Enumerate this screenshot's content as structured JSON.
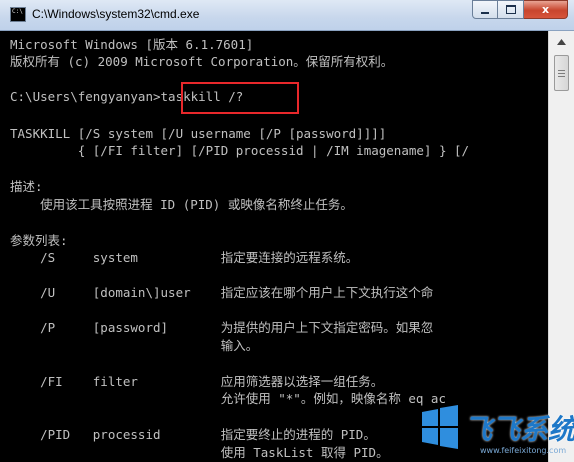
{
  "window": {
    "title": "C:\\Windows\\system32\\cmd.exe",
    "icon_text": "C:\\",
    "close_glyph": "x"
  },
  "console": {
    "lines": [
      "Microsoft Windows [版本 6.1.7601]",
      "版权所有 (c) 2009 Microsoft Corporation。保留所有权利。",
      "",
      "C:\\Users\\fengyanyan>taskkill /?",
      "",
      "TASKKILL [/S system [/U username [/P [password]]]]",
      "         { [/FI filter] [/PID processid | /IM imagename] } [/",
      "",
      "描述:",
      "    使用该工具按照进程 ID (PID) 或映像名称终止任务。",
      "",
      "参数列表:",
      "    /S     system           指定要连接的远程系统。",
      "",
      "    /U     [domain\\]user    指定应该在哪个用户上下文执行这个命",
      "",
      "    /P     [password]       为提供的用户上下文指定密码。如果忽",
      "                            输入。",
      "",
      "    /FI    filter           应用筛选器以选择一组任务。",
      "                            允许使用 \"*\"。例如，映像名称 eq ac",
      "",
      "    /PID   processid        指定要终止的进程的 PID。",
      "                            使用 TaskList 取得 PID。"
    ]
  },
  "watermark": {
    "text": "飞飞系统",
    "url": "www.feifeixitong.com"
  },
  "colors": {
    "console_bg": "#000000",
    "console_fg": "#c0c0c0",
    "highlight": "#e8282b",
    "watermark": "#1e78c8"
  }
}
